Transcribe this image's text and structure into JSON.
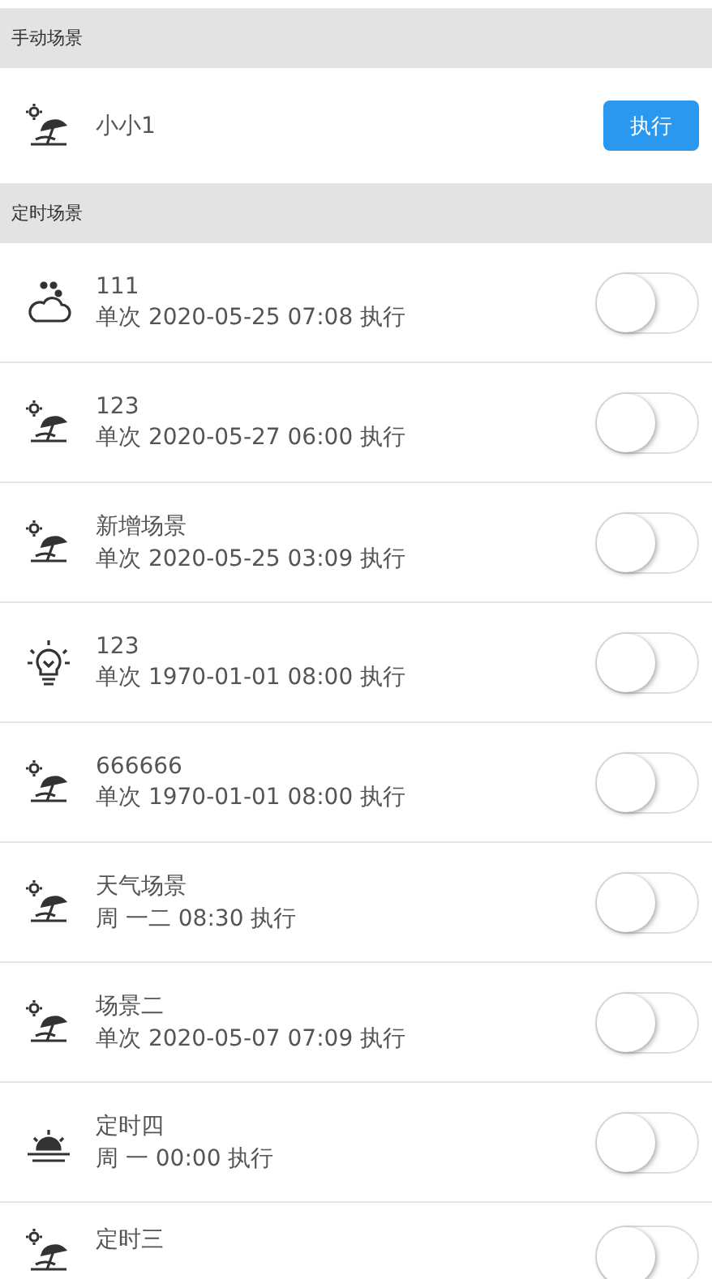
{
  "manual_section": {
    "title": "手动场景",
    "scenes": [
      {
        "kind": "beach",
        "name": "小小1",
        "button": "执行"
      }
    ]
  },
  "timed_section": {
    "title": "定时场景",
    "scenes": [
      {
        "kind": "cloud",
        "name": "111",
        "schedule": "单次 2020-05-25 07:08 执行",
        "on": false
      },
      {
        "kind": "beach",
        "name": "123",
        "schedule": "单次 2020-05-27 06:00 执行",
        "on": false
      },
      {
        "kind": "beach",
        "name": "新增场景",
        "schedule": "单次 2020-05-25 03:09 执行",
        "on": false
      },
      {
        "kind": "bulb",
        "name": "123",
        "schedule": "单次 1970-01-01 08:00 执行",
        "on": false
      },
      {
        "kind": "beach",
        "name": "666666",
        "schedule": "单次 1970-01-01 08:00 执行",
        "on": false
      },
      {
        "kind": "beach",
        "name": "天气场景",
        "schedule": "周 一二 08:30 执行",
        "on": false
      },
      {
        "kind": "beach",
        "name": "场景二",
        "schedule": "单次 2020-05-07 07:09 执行",
        "on": false
      },
      {
        "kind": "sunrise",
        "name": "定时四",
        "schedule": "周 一 00:00 执行",
        "on": false
      },
      {
        "kind": "beach",
        "name": "定时三",
        "on": false
      }
    ]
  }
}
